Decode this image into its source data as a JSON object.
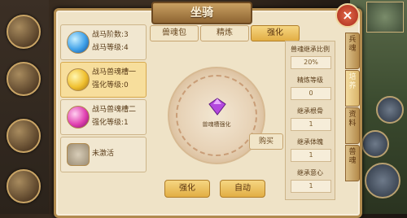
{
  "panel": {
    "title": "坐骑"
  },
  "tabs": [
    {
      "label": "兽魂包",
      "active": false
    },
    {
      "label": "精炼",
      "active": false
    },
    {
      "label": "强化",
      "active": true
    }
  ],
  "slots": [
    {
      "line1": "战马阶数:3",
      "line2": "战马等级:4",
      "gem": "blue-gem-icon",
      "active": false
    },
    {
      "line1": "战马兽魂槽一",
      "line2": "强化等级:0",
      "gem": "gold-coin-icon",
      "active": true
    },
    {
      "line1": "战马兽魂槽二",
      "line2": "强化等级:1",
      "gem": "pink-gem-icon",
      "active": false
    },
    {
      "line1": "未激活",
      "line2": "",
      "gem": "lock-icon",
      "active": false
    }
  ],
  "center": {
    "label": "兽魂槽强化",
    "buy_label": "购买"
  },
  "stats": [
    {
      "label": "兽魂继承比例",
      "value": "20%"
    },
    {
      "label": "精炼等级",
      "value": "0"
    },
    {
      "label": "继承根骨",
      "value": "1"
    },
    {
      "label": "继承体魄",
      "value": "1"
    },
    {
      "label": "继承意心",
      "value": "1"
    }
  ],
  "buttons": {
    "strengthen": "强化",
    "auto": "自动"
  },
  "side_tabs": [
    "兵魂",
    "培养",
    "资料",
    "兽魂"
  ],
  "colors": {
    "accent": "#e2ae44",
    "panel_bg": "#efe3c7",
    "border": "#b08a4e"
  }
}
